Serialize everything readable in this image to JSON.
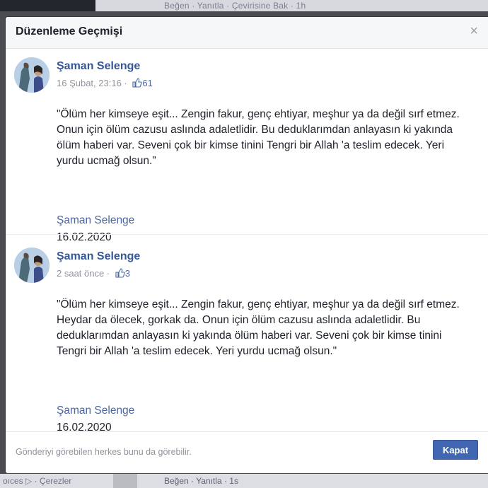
{
  "background": {
    "top_text": "Beğen · Yanıtla · Çevirisine Bak · 1h",
    "bottom_left": "oıces ▷ · Çerezler",
    "bottom_right": "Beğen · Yanıtla · 1s"
  },
  "modal": {
    "title": "Düzenleme Geçmişi",
    "close_label": "×",
    "entries": [
      {
        "author": "Şaman Selenge",
        "time": "16 Şubat, 23:16 ·",
        "likes": "61",
        "text": "\"Ölüm her kimseye eşit... Zengin fakur, genç ehtiyar, meşhur ya da değil sırf etmez. Onun için ölüm cazusu aslında adaletlidir. Bu deduklarımdan anlayasın ki yakında ölüm haberi var. Seveni çok bir kimse tinini Tengri bir Allah 'a teslim edecek. Yeri yurdu ucmağ olsun.\"",
        "signature_name": "Şaman Selenge",
        "signature_date": "16.02.2020"
      },
      {
        "author": "Şaman Selenge",
        "time": "2 saat önce ·",
        "likes": "3",
        "text": "\"Ölüm her kimseye eşit... Zengin fakur, genç ehtiyar, meşhur ya da değil sırf etmez. Heydar da ölecek, gorkak da. Onun için ölüm cazusu aslında adaletlidir. Bu deduklarımdan anlayasın ki yakında ölüm haberi var. Seveni çok bir kimse tinini Tengri bir Allah 'a teslim edecek. Yeri yurdu ucmağ olsun.\"",
        "signature_name": "Şaman Selenge",
        "signature_date": "16.02.2020"
      }
    ],
    "footer_note": "Gönderiyi görebilen herkes bunu da görebilir.",
    "close_button": "Kapat"
  },
  "colors": {
    "link_blue": "#365899",
    "button_blue": "#4267b2",
    "muted_gray": "#90949c"
  },
  "icons": [
    "close-icon",
    "thumbs-up-icon",
    "avatar"
  ]
}
